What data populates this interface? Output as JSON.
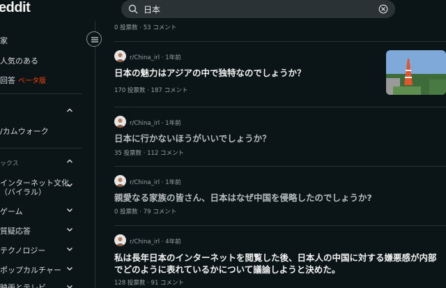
{
  "header": {
    "logo": "eddit",
    "search_value": "日本"
  },
  "sidebar": {
    "items": [
      {
        "label": "家"
      },
      {
        "label": "人気のある"
      },
      {
        "label": "回答",
        "badge": "ベータ版"
      }
    ],
    "community_item": "/カムウォーク",
    "section_label": "ックス",
    "topics": [
      {
        "label": "インターネット文化"
      },
      {
        "label": "（バイラル）"
      },
      {
        "label": "ゲーム"
      },
      {
        "label": "質疑応答"
      },
      {
        "label": "テクノロジー"
      },
      {
        "label": "ポップカルチャー"
      },
      {
        "label": "映画とテレビ"
      }
    ]
  },
  "feed": {
    "top_stats": "0 投票数 · 53 コメント",
    "posts": [
      {
        "meta": "r/China_irl · 1年前",
        "title": "日本の魅力はアジアの中で独特なのでしょうか？",
        "stats": "170 投票数 · 187 コメント",
        "has_thumbnail": true
      },
      {
        "meta": "r/China_irl · 1年前",
        "title": "日本に行かないほうがいいでしょうか？",
        "stats": "35 投票数 · 112 コメント"
      },
      {
        "meta": "r/China_irl · 1年前",
        "title": "親愛なる家族の皆さん、日本はなぜ中国を侵略したのでしょうか?",
        "stats": "0 投票数 · 79 コメント"
      },
      {
        "meta": "r/China_irl · 4年前",
        "title_line1": "私は長年日本のインターネットを閲覧した後、日本人の中国に対する嫌悪感が内部",
        "title_line2": "でどのように表れているかについて議論しようと決めた。",
        "stats": "128 投票数 · 91 コメント"
      }
    ]
  },
  "colors": {
    "background": "#0b1416",
    "accent": "#ff4500",
    "text": "#f2f2f2",
    "muted": "#9aa3a6"
  },
  "icons": [
    "search-icon",
    "clear-icon",
    "menu-icon",
    "chevron-up-icon",
    "chevron-down-icon",
    "avatar"
  ]
}
